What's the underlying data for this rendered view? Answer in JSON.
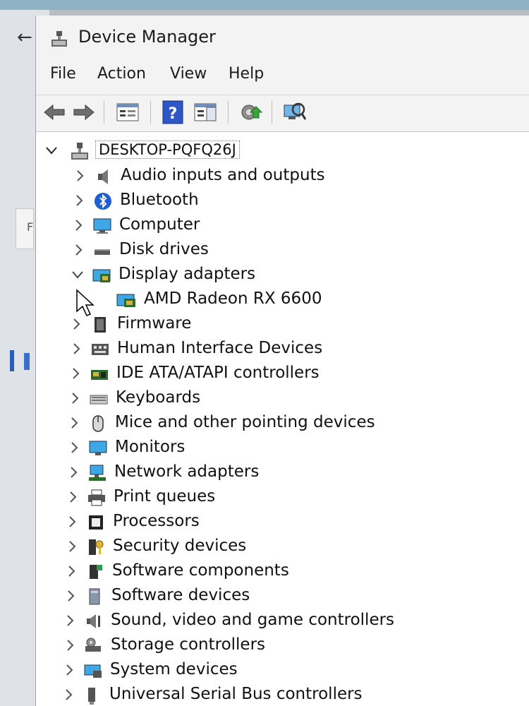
{
  "window": {
    "title": "Device Manager"
  },
  "menu": [
    "File",
    "Action",
    "View",
    "Help"
  ],
  "toolbar_icons": [
    "back-arrow-icon",
    "forward-arrow-icon",
    "properties-list-icon",
    "help-icon",
    "details-pane-icon",
    "update-driver-icon",
    "scan-hardware-icon"
  ],
  "tree": {
    "root": "DESKTOP-PQFQ26J",
    "categories": [
      {
        "label": "Audio inputs and outputs",
        "icon": "speaker-icon",
        "expanded": false
      },
      {
        "label": "Bluetooth",
        "icon": "bluetooth-icon",
        "expanded": false
      },
      {
        "label": "Computer",
        "icon": "computer-monitor-icon",
        "expanded": false
      },
      {
        "label": "Disk drives",
        "icon": "disk-drive-icon",
        "expanded": false
      },
      {
        "label": "Display adapters",
        "icon": "display-adapter-icon",
        "expanded": true,
        "children": [
          "AMD Radeon RX 6600"
        ]
      },
      {
        "label": "Firmware",
        "icon": "firmware-chip-icon",
        "expanded": false
      },
      {
        "label": "Human Interface Devices",
        "icon": "hid-icon",
        "expanded": false
      },
      {
        "label": "IDE ATA/ATAPI controllers",
        "icon": "ide-controller-icon",
        "expanded": false
      },
      {
        "label": "Keyboards",
        "icon": "keyboard-icon",
        "expanded": false
      },
      {
        "label": "Mice and other pointing devices",
        "icon": "mouse-icon",
        "expanded": false
      },
      {
        "label": "Monitors",
        "icon": "monitor-icon",
        "expanded": false
      },
      {
        "label": "Network adapters",
        "icon": "network-adapter-icon",
        "expanded": false
      },
      {
        "label": "Print queues",
        "icon": "printer-icon",
        "expanded": false
      },
      {
        "label": "Processors",
        "icon": "processor-icon",
        "expanded": false
      },
      {
        "label": "Security devices",
        "icon": "security-key-icon",
        "expanded": false
      },
      {
        "label": "Software components",
        "icon": "software-component-icon",
        "expanded": false
      },
      {
        "label": "Software devices",
        "icon": "software-device-icon",
        "expanded": false
      },
      {
        "label": "Sound, video and game controllers",
        "icon": "sound-controller-icon",
        "expanded": false
      },
      {
        "label": "Storage controllers",
        "icon": "storage-controller-icon",
        "expanded": false
      },
      {
        "label": "System devices",
        "icon": "system-devices-icon",
        "expanded": false
      },
      {
        "label": "Universal Serial Bus controllers",
        "icon": "usb-icon",
        "expanded": false
      }
    ]
  },
  "colors": {
    "accent": "#2b63c9",
    "tree_background": "#ffffff",
    "chrome_background": "#f3f3f3"
  }
}
